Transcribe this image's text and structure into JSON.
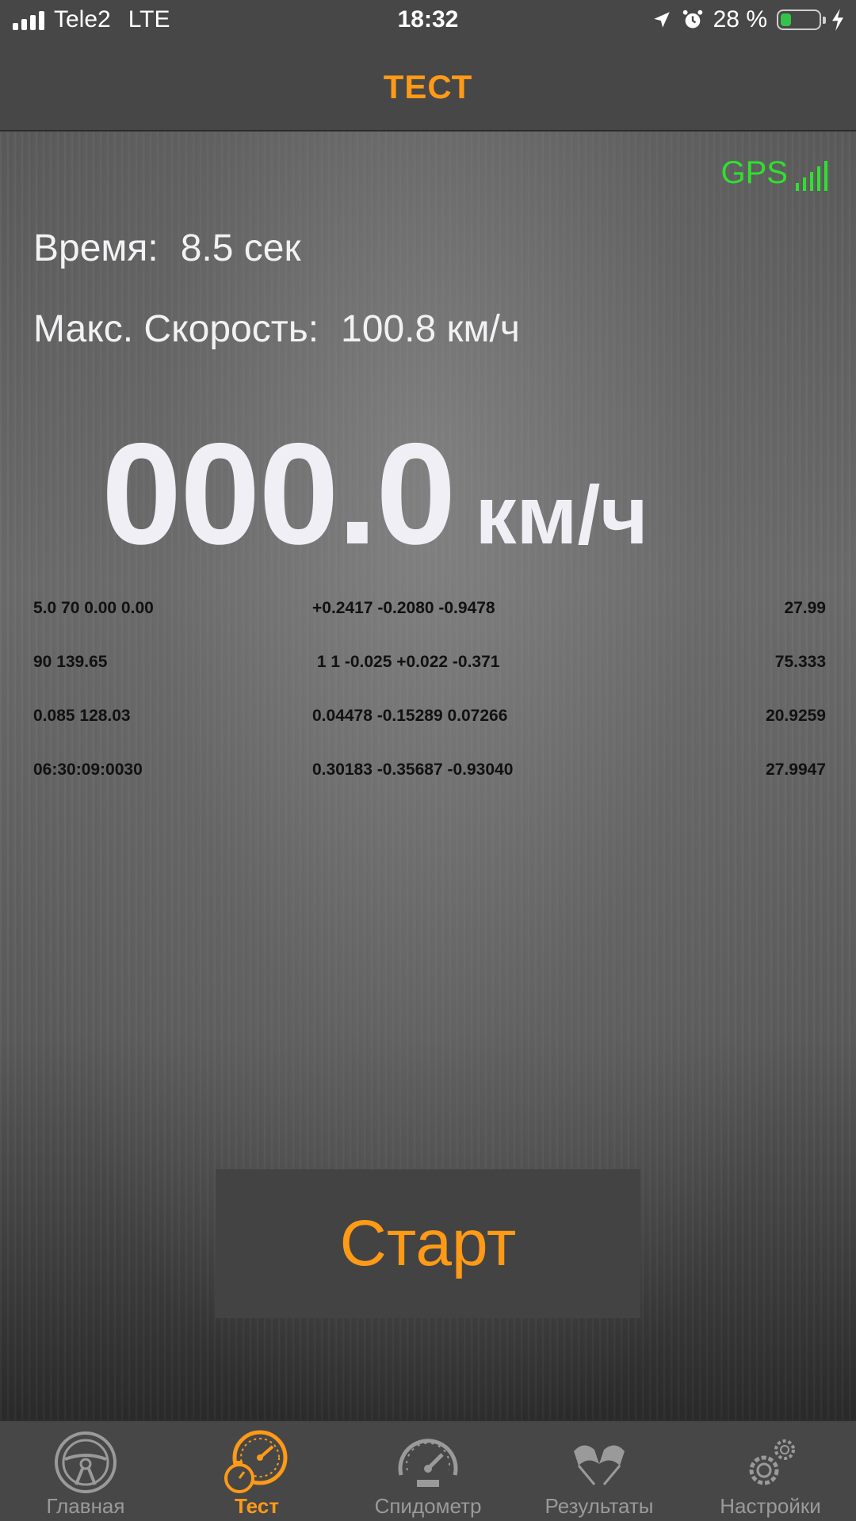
{
  "status_bar": {
    "carrier": "Tele2",
    "network": "LTE",
    "time": "18:32",
    "battery_text": "28 %",
    "battery_level": 0.28
  },
  "nav": {
    "title": "ТЕСТ"
  },
  "gps": {
    "label": "GPS",
    "signal_color": "#2fe02f"
  },
  "time_line": {
    "label": "Время:",
    "value": "8.5 сек"
  },
  "max_speed_line": {
    "label": "Макс. Скорость:",
    "value": "100.8 км/ч"
  },
  "speed": {
    "value": "000.0",
    "unit": "км/ч"
  },
  "debug_rows": [
    [
      "5.0 70 0.00 0.00",
      "+0.2417 -0.2080 -0.9478",
      "27.99"
    ],
    [
      "90 139.65",
      " 1 1 -0.025 +0.022 -0.371",
      "75.333"
    ],
    [
      "0.085 128.03",
      "0.04478 -0.15289 0.07266",
      "20.9259"
    ],
    [
      "06:30:09:0030",
      "0.30183 -0.35687 -0.93040",
      "27.9947"
    ]
  ],
  "start_button": {
    "label": "Старт"
  },
  "tabs": [
    {
      "label": "Главная",
      "icon": "steering-wheel-icon",
      "active": false
    },
    {
      "label": "Тест",
      "icon": "stopwatch-gauge-icon",
      "active": true
    },
    {
      "label": "Спидометр",
      "icon": "speedometer-icon",
      "active": false
    },
    {
      "label": "Результаты",
      "icon": "racing-flags-icon",
      "active": false
    },
    {
      "label": "Настройки",
      "icon": "gears-icon",
      "active": false
    }
  ],
  "colors": {
    "accent": "#ff9a16",
    "bar": "#474747",
    "text": "#f2f2f4"
  }
}
